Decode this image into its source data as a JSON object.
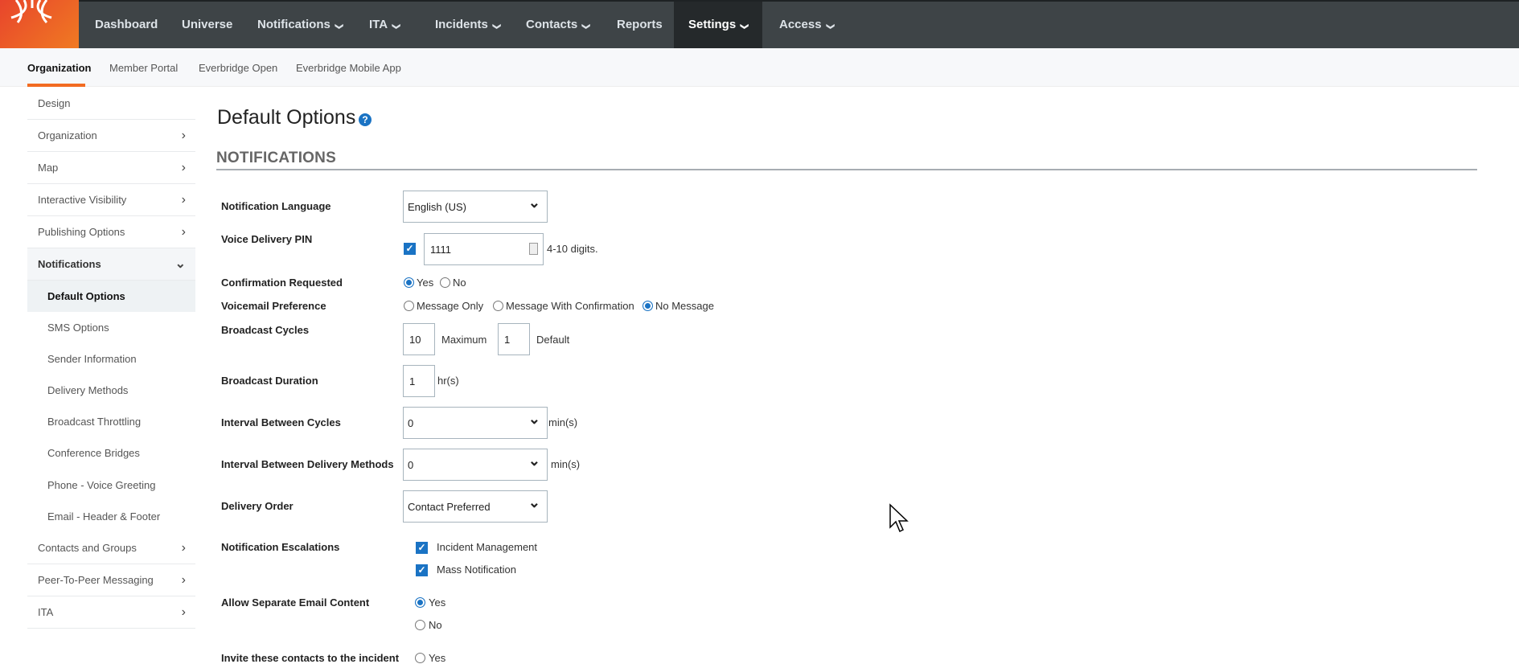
{
  "nav": {
    "items": [
      {
        "label": "Dashboard",
        "dropdown": false
      },
      {
        "label": "Universe",
        "dropdown": false
      },
      {
        "label": "Notifications",
        "dropdown": true
      },
      {
        "label": "ITA",
        "dropdown": true
      },
      {
        "label": "Incidents",
        "dropdown": true
      },
      {
        "label": "Contacts",
        "dropdown": true
      },
      {
        "label": "Reports",
        "dropdown": false
      },
      {
        "label": "Settings",
        "dropdown": true,
        "active": true
      },
      {
        "label": "Access",
        "dropdown": true
      }
    ]
  },
  "subnav": {
    "items": [
      "Organization",
      "Member Portal",
      "Everbridge Open",
      "Everbridge Mobile App"
    ],
    "active": "Organization"
  },
  "sidebar": {
    "items": [
      "Design",
      "Organization",
      "Map",
      "Interactive Visibility",
      "Publishing Options",
      "Notifications",
      "Default Options",
      "SMS Options",
      "Sender Information",
      "Delivery Methods",
      "Broadcast Throttling",
      "Conference Bridges",
      "Phone - Voice Greeting",
      "Email - Header & Footer",
      "Contacts and Groups",
      "Peer-To-Peer Messaging",
      "ITA"
    ]
  },
  "page": {
    "title": "Default Options",
    "section": "NOTIFICATIONS"
  },
  "form": {
    "notification_language": {
      "label": "Notification Language",
      "value": "English (US)"
    },
    "voice_pin": {
      "label": "Voice Delivery PIN",
      "value": "1111",
      "hint": "4-10 digits.",
      "checked": true
    },
    "confirmation": {
      "label": "Confirmation Requested",
      "options": [
        "Yes",
        "No"
      ],
      "selected": "Yes"
    },
    "voicemail": {
      "label": "Voicemail Preference",
      "options": [
        "Message Only",
        "Message With Confirmation",
        "No Message"
      ],
      "selected": "No Message"
    },
    "cycles": {
      "label": "Broadcast Cycles",
      "max": "10",
      "max_label": "Maximum",
      "default": "1",
      "default_label": "Default"
    },
    "duration": {
      "label": "Broadcast Duration",
      "value": "1",
      "unit": "hr(s)"
    },
    "interval_cycles": {
      "label": "Interval Between Cycles",
      "value": "0",
      "unit": "min(s)"
    },
    "interval_methods": {
      "label": "Interval Between Delivery Methods",
      "value": "0",
      "unit": "min(s)"
    },
    "delivery_order": {
      "label": "Delivery Order",
      "value": "Contact Preferred"
    },
    "escalations": {
      "label": "Notification Escalations",
      "options": [
        "Incident Management",
        "Mass Notification"
      ]
    },
    "separate_email": {
      "label": "Allow Separate Email Content",
      "options": [
        "Yes",
        "No"
      ],
      "selected": "Yes"
    },
    "invite": {
      "label": "Invite these contacts to the incident",
      "options": [
        "Yes"
      ]
    }
  },
  "colors": {
    "accent": "#f26b21",
    "primary": "#1a73c4",
    "nav": "#3e4447"
  }
}
